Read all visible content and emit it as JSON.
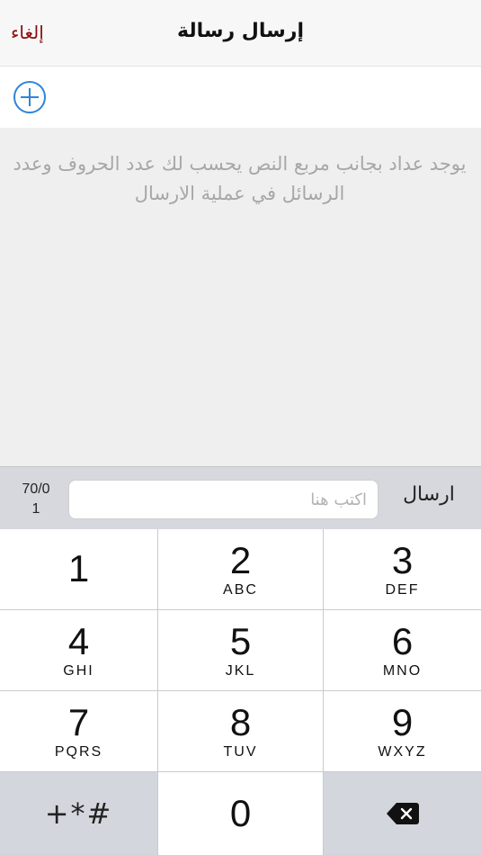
{
  "navbar": {
    "title": "إرسال رسالة",
    "cancel_label": "إلغاء"
  },
  "recipient": {
    "add_icon": "plus-circle-icon",
    "accent_color": "#2f84d8"
  },
  "message": {
    "hint": "يوجد عداد بجانب مربع النص يحسب لك عدد الحروف وعدد الرسائل في عملية الارسال"
  },
  "input_bar": {
    "counter_chars": "70/0",
    "counter_messages": "1",
    "placeholder": "اكتب هنا",
    "value": "",
    "send_label": "ارسال"
  },
  "keypad": {
    "keys": [
      {
        "digit": "1",
        "letters": ""
      },
      {
        "digit": "2",
        "letters": "ABC"
      },
      {
        "digit": "3",
        "letters": "DEF"
      },
      {
        "digit": "4",
        "letters": "GHI"
      },
      {
        "digit": "5",
        "letters": "JKL"
      },
      {
        "digit": "6",
        "letters": "MNO"
      },
      {
        "digit": "7",
        "letters": "PQRS"
      },
      {
        "digit": "8",
        "letters": "TUV"
      },
      {
        "digit": "9",
        "letters": "WXYZ"
      }
    ],
    "symbols_label": "+*#",
    "zero": "0",
    "delete_icon": "backspace-icon"
  },
  "colors": {
    "cancel": "#8b0d0d",
    "accent": "#2f84d8"
  }
}
